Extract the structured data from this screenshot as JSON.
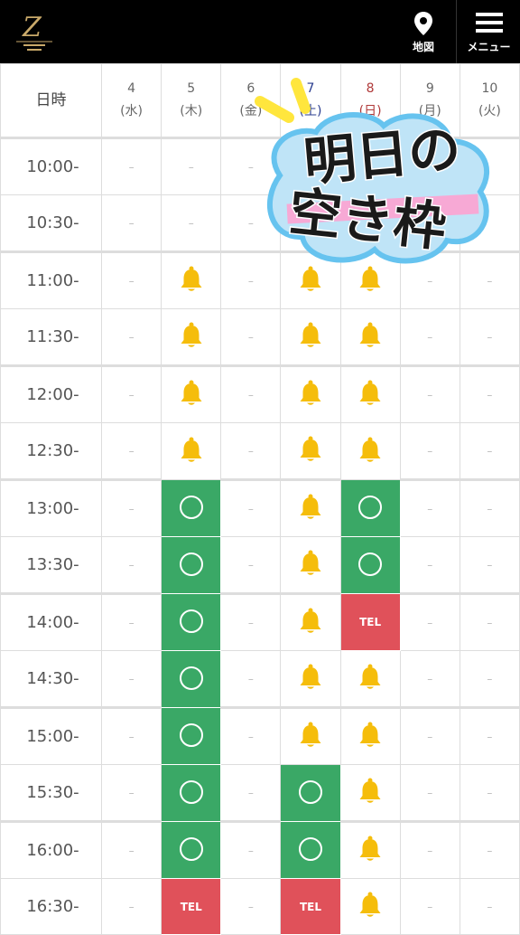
{
  "header": {
    "map_label": "地図",
    "menu_label": "メニュー",
    "colors": {
      "bg": "#000000",
      "text": "#ffffff"
    }
  },
  "table": {
    "head_label": "日時",
    "days": [
      {
        "num": "4",
        "dow": "(水)"
      },
      {
        "num": "5",
        "dow": "(木)"
      },
      {
        "num": "6",
        "dow": "(金)"
      },
      {
        "num": "7",
        "dow": "(土)"
      },
      {
        "num": "8",
        "dow": "(日)"
      },
      {
        "num": "9",
        "dow": "(月)"
      },
      {
        "num": "10",
        "dow": "(火)"
      }
    ],
    "rows": [
      {
        "time": "10:00-",
        "cells": [
          "dash",
          "dash",
          "dash",
          "hidden",
          "hidden",
          "hidden",
          "hidden"
        ]
      },
      {
        "time": "10:30-",
        "cells": [
          "dash",
          "dash",
          "dash",
          "hidden",
          "hidden",
          "hidden",
          "hidden"
        ]
      },
      {
        "time": "11:00-",
        "cells": [
          "dash",
          "bell",
          "dash",
          "bell",
          "bell",
          "dash",
          "dash"
        ]
      },
      {
        "time": "11:30-",
        "cells": [
          "dash",
          "bell",
          "dash",
          "bell",
          "bell",
          "dash",
          "dash"
        ]
      },
      {
        "time": "12:00-",
        "cells": [
          "dash",
          "bell",
          "dash",
          "bell",
          "bell",
          "dash",
          "dash"
        ]
      },
      {
        "time": "12:30-",
        "cells": [
          "dash",
          "bell",
          "dash",
          "bell",
          "bell",
          "dash",
          "dash"
        ]
      },
      {
        "time": "13:00-",
        "cells": [
          "dash",
          "open",
          "dash",
          "bell",
          "open",
          "dash",
          "dash"
        ]
      },
      {
        "time": "13:30-",
        "cells": [
          "dash",
          "open",
          "dash",
          "bell",
          "open",
          "dash",
          "dash"
        ]
      },
      {
        "time": "14:00-",
        "cells": [
          "dash",
          "open",
          "dash",
          "bell",
          "tel",
          "dash",
          "dash"
        ]
      },
      {
        "time": "14:30-",
        "cells": [
          "dash",
          "open",
          "dash",
          "bell",
          "bell",
          "dash",
          "dash"
        ]
      },
      {
        "time": "15:00-",
        "cells": [
          "dash",
          "open",
          "dash",
          "bell",
          "bell",
          "dash",
          "dash"
        ]
      },
      {
        "time": "15:30-",
        "cells": [
          "dash",
          "open",
          "dash",
          "open",
          "bell",
          "dash",
          "dash"
        ]
      },
      {
        "time": "16:00-",
        "cells": [
          "dash",
          "open",
          "dash",
          "open",
          "bell",
          "dash",
          "dash"
        ]
      },
      {
        "time": "16:30-",
        "cells": [
          "dash",
          "tel",
          "dash",
          "tel",
          "bell",
          "dash",
          "dash"
        ]
      }
    ],
    "dash_text": "–",
    "tel_text": "TEL",
    "colors": {
      "open": "#3aa866",
      "tel": "#e0515a",
      "bell": "#f5bd0b",
      "saturday": "#2a3d8f",
      "sunday": "#b03a3a"
    }
  },
  "overlay": {
    "line1": "明日の",
    "line2": "空き枠"
  }
}
